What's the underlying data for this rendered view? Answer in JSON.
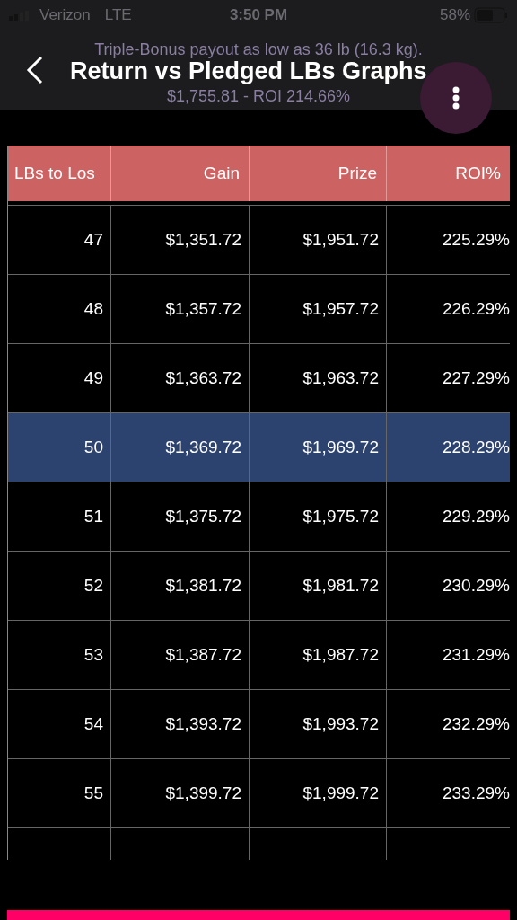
{
  "status_bar": {
    "carrier": "Verizon",
    "network": "LTE",
    "time": "3:50 PM",
    "battery": "58%"
  },
  "header": {
    "title": "Return vs Pledged LBs Graphs",
    "subtitle_lines": [
      "Triple-Bonus payout as low as 36 lb (16.3 kg).",
      "$1,755.81 - ROI 214.66%"
    ]
  },
  "table": {
    "columns": [
      "LBs to Los",
      "Gain",
      "Prize",
      "ROI%"
    ],
    "rows": [
      {
        "cells": [
          "47",
          "$1,351.72",
          "$1,951.72",
          "225.29%"
        ],
        "selected": false
      },
      {
        "cells": [
          "48",
          "$1,357.72",
          "$1,957.72",
          "226.29%"
        ],
        "selected": false
      },
      {
        "cells": [
          "49",
          "$1,363.72",
          "$1,963.72",
          "227.29%"
        ],
        "selected": false
      },
      {
        "cells": [
          "50",
          "$1,369.72",
          "$1,969.72",
          "228.29%"
        ],
        "selected": true
      },
      {
        "cells": [
          "51",
          "$1,375.72",
          "$1,975.72",
          "229.29%"
        ],
        "selected": false
      },
      {
        "cells": [
          "52",
          "$1,381.72",
          "$1,981.72",
          "230.29%"
        ],
        "selected": false
      },
      {
        "cells": [
          "53",
          "$1,387.72",
          "$1,987.72",
          "231.29%"
        ],
        "selected": false
      },
      {
        "cells": [
          "54",
          "$1,393.72",
          "$1,993.72",
          "232.29%"
        ],
        "selected": false
      },
      {
        "cells": [
          "55",
          "$1,399.72",
          "$1,999.72",
          "233.29%"
        ],
        "selected": false
      }
    ]
  }
}
